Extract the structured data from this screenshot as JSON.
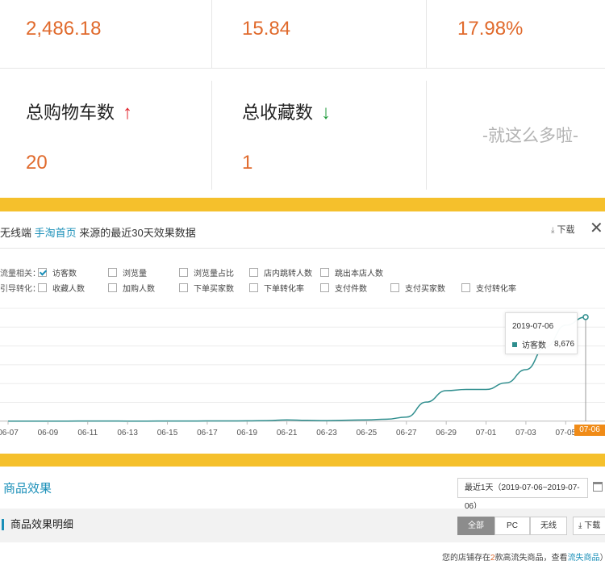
{
  "stats": {
    "row1": [
      "2,486.18",
      "15.84",
      "17.98%"
    ],
    "cart_label": "总购物车数",
    "cart_value": "20",
    "fav_label": "总收藏数",
    "fav_value": "1",
    "arrow_up": "↑",
    "arrow_down": "↓",
    "done_text": "-就这么多啦-"
  },
  "dialog": {
    "title_prefix": "无线端",
    "title_link": "手淘首页",
    "title_suffix": "来源的最近30天效果数据",
    "download_label": "下载",
    "download_icon": "download-icon",
    "close_icon": "close-icon",
    "close_glyph": "✕",
    "row1_label": "流量相关：",
    "row2_label": "引导转化：",
    "options_row1": [
      {
        "label": "访客数",
        "checked": true
      },
      {
        "label": "浏览量",
        "checked": false
      },
      {
        "label": "浏览量占比",
        "checked": false
      },
      {
        "label": "店内跳转人数",
        "checked": false
      },
      {
        "label": "跳出本店人数",
        "checked": false
      }
    ],
    "options_row2": [
      {
        "label": "收藏人数",
        "checked": false
      },
      {
        "label": "加购人数",
        "checked": false
      },
      {
        "label": "下单买家数",
        "checked": false
      },
      {
        "label": "下单转化率",
        "checked": false
      },
      {
        "label": "支付件数",
        "checked": false
      },
      {
        "label": "支付买家数",
        "checked": false
      },
      {
        "label": "支付转化率",
        "checked": false
      }
    ],
    "tooltip": {
      "date": "2019-07-06",
      "series": "访客数",
      "value": "8,676"
    },
    "highlight_tick": "07-06"
  },
  "chart_data": {
    "type": "line",
    "x": [
      "06-07",
      "06-08",
      "06-09",
      "06-10",
      "06-11",
      "06-12",
      "06-13",
      "06-14",
      "06-15",
      "06-16",
      "06-17",
      "06-18",
      "06-19",
      "06-20",
      "06-21",
      "06-22",
      "06-23",
      "06-24",
      "06-25",
      "06-26",
      "06-27",
      "06-28",
      "06-29",
      "06-30",
      "07-01",
      "07-02",
      "07-03",
      "07-04",
      "07-05",
      "07-06"
    ],
    "tick_labels": [
      "06-07",
      "06-09",
      "06-11",
      "06-13",
      "06-15",
      "06-17",
      "06-19",
      "06-21",
      "06-23",
      "06-25",
      "06-27",
      "06-29",
      "07-01",
      "07-03",
      "07-05"
    ],
    "series": [
      {
        "name": "访客数",
        "color": "#2f8e8e",
        "values": [
          20,
          20,
          20,
          20,
          25,
          25,
          20,
          20,
          25,
          25,
          30,
          30,
          40,
          60,
          120,
          80,
          60,
          90,
          120,
          180,
          350,
          1600,
          2550,
          2650,
          2650,
          3200,
          4300,
          6200,
          8000,
          8676
        ]
      }
    ],
    "ylim": [
      0,
      9000
    ],
    "grid": true
  },
  "bottom": {
    "section_title": "商品效果",
    "date_range": "最近1天（2019-07-06~2019-07-06）",
    "calendar_icon": "calendar-icon",
    "sub_title": "商品效果明细",
    "tabs": [
      "全部",
      "PC",
      "无线"
    ],
    "download_label": "下载",
    "note_prefix": "您的店铺存在",
    "note_count": "2",
    "note_mid": "款高流失商品，查看",
    "note_link": "流失商品",
    "note_suffix": "）"
  },
  "colors": {
    "accent": "#1a8fb8",
    "value_orange": "#e06a2c",
    "banner_yellow": "#f5c02c",
    "line": "#2f8e8e",
    "highlight": "#f08b17"
  }
}
